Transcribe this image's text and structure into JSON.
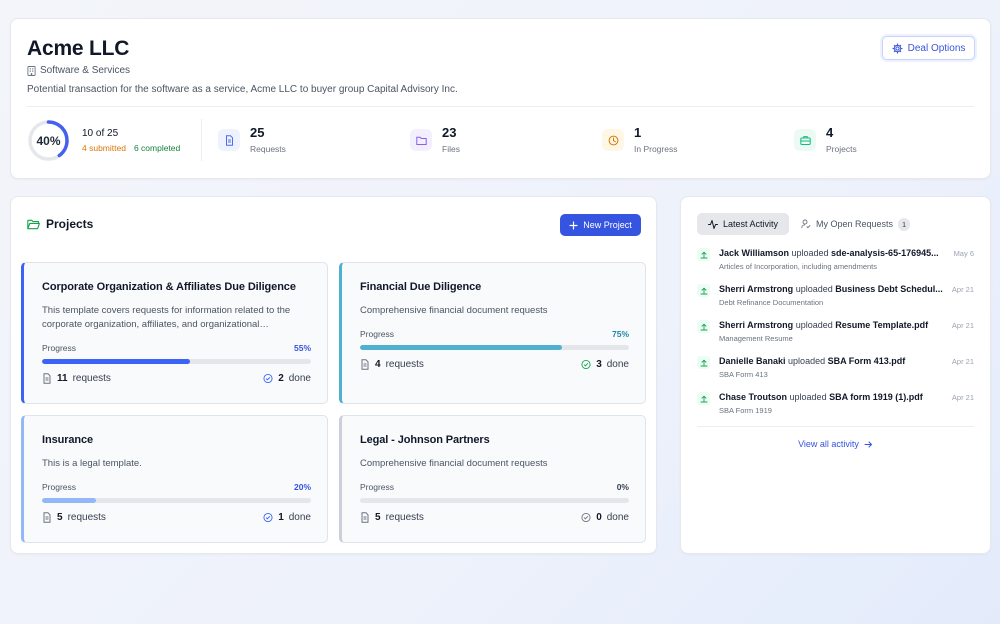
{
  "colors": {
    "brand_blue": "#3554e0",
    "submitted_orange": "#d97706",
    "completed_green": "#15803d",
    "ring_track": "#e5e7eb",
    "ring_fill": "#4361ee"
  },
  "deal": {
    "name": "Acme LLC",
    "industry": "Software & Services",
    "description": "Potential transaction for the software as a service, Acme LLC to buyer group Capital Advisory Inc.",
    "options_label": "Deal Options",
    "progress_percent": 40,
    "progress_label": "40%",
    "progress_main": "10 of 25",
    "submitted_text": "4 submitted",
    "completed_text": "6 completed"
  },
  "stats": [
    {
      "value": "25",
      "label": "Requests",
      "icon": "document-icon",
      "color": "#4f6bed",
      "bg": "#eef1fe"
    },
    {
      "value": "23",
      "label": "Files",
      "icon": "folder-icon",
      "color": "#8b5cf6",
      "bg": "#f3efff"
    },
    {
      "value": "1",
      "label": "In Progress",
      "icon": "clock-icon",
      "color": "#d97706",
      "bg": "#fff7e6"
    },
    {
      "value": "4",
      "label": "Projects",
      "icon": "briefcase-icon",
      "color": "#10b981",
      "bg": "#ebfaf3"
    }
  ],
  "projects_section": {
    "title": "Projects",
    "new_project_label": "New Project",
    "items": [
      {
        "name": "Corporate Organization & Affiliates Due Diligence",
        "description": "This template covers requests for information related to the corporate organization, affiliates, and organizational…",
        "progress_label": "Progress",
        "percent": 55,
        "percent_label": "55%",
        "accent": "#3b63f6",
        "pct_color": "#3554e0",
        "requests_count": "11",
        "requests_label": "requests",
        "done_count": "2",
        "done_label": "done"
      },
      {
        "name": "Financial Due Diligence",
        "description": "Comprehensive financial document requests",
        "progress_label": "Progress",
        "percent": 75,
        "percent_label": "75%",
        "accent": "#4fb0cf",
        "pct_color": "#1e88a8",
        "requests_count": "4",
        "requests_label": "requests",
        "done_count": "3",
        "done_label": "done"
      },
      {
        "name": "Insurance",
        "description": "This is a legal template.",
        "progress_label": "Progress",
        "percent": 20,
        "percent_label": "20%",
        "accent": "#93b7f7",
        "pct_color": "#3554e0",
        "requests_count": "5",
        "requests_label": "requests",
        "done_count": "1",
        "done_label": "done"
      },
      {
        "name": "Legal - Johnson Partners",
        "description": "Comprehensive financial document requests",
        "progress_label": "Progress",
        "percent": 0,
        "percent_label": "0%",
        "accent": "#c9d0da",
        "pct_color": "#374151",
        "requests_count": "5",
        "requests_label": "requests",
        "done_count": "0",
        "done_label": "done"
      }
    ]
  },
  "activity": {
    "tab_latest": "Latest Activity",
    "tab_open": "My Open Requests",
    "tab_open_count": "1",
    "items": [
      {
        "user": "Jack Williamson",
        "action": "uploaded",
        "file": "sde-analysis-65-176945...",
        "date": "May 6",
        "subtitle": "Articles of Incorporation, including amendments"
      },
      {
        "user": "Sherri Armstrong",
        "action": "uploaded",
        "file": "Business Debt Schedul...",
        "date": "Apr 21",
        "subtitle": "Debt Refinance Documentation"
      },
      {
        "user": "Sherri Armstrong",
        "action": "uploaded",
        "file": "Resume Template.pdf",
        "date": "Apr 21",
        "subtitle": "Management Resume"
      },
      {
        "user": "Danielle Banaki",
        "action": "uploaded",
        "file": "SBA Form 413.pdf",
        "date": "Apr 21",
        "subtitle": "SBA Form 413"
      },
      {
        "user": "Chase Troutson",
        "action": "uploaded",
        "file": "SBA form 1919 (1).pdf",
        "date": "Apr 21",
        "subtitle": "SBA Form 1919"
      }
    ],
    "view_all_label": "View all activity"
  }
}
